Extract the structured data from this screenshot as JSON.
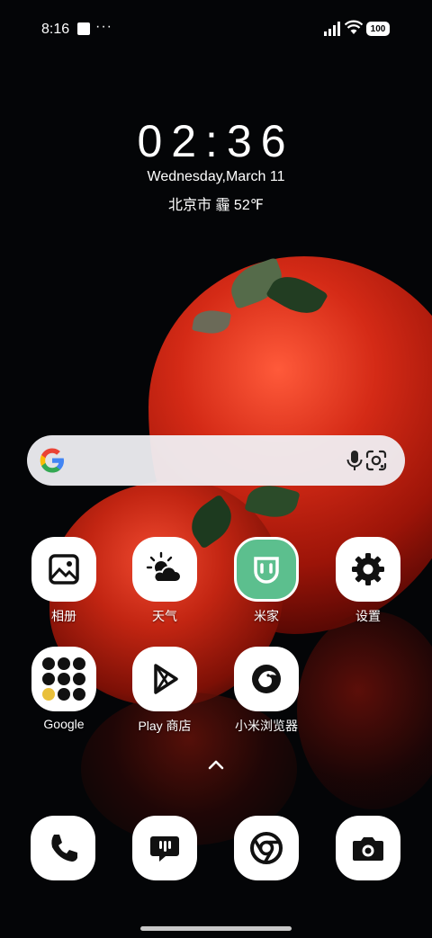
{
  "status_bar": {
    "time": "8:16",
    "dots": "···",
    "battery": "100"
  },
  "clock_widget": {
    "time": "02:36",
    "date": "Wednesday,March 11",
    "weather": "北京市 霾 52℉"
  },
  "search_bar": {
    "logo_icon": "google-g-icon",
    "mic_icon": "mic-icon",
    "lens_icon": "google-lens-icon"
  },
  "apps": [
    {
      "label": "相册",
      "icon": "photos-icon"
    },
    {
      "label": "天气",
      "icon": "weather-icon"
    },
    {
      "label": "米家",
      "icon": "mijia-icon"
    },
    {
      "label": "设置",
      "icon": "settings-gear-icon"
    },
    {
      "label": "Google",
      "icon": "google-folder-icon"
    },
    {
      "label": "Play 商店",
      "icon": "play-store-icon"
    },
    {
      "label": "小米浏览器",
      "icon": "mi-browser-icon"
    }
  ],
  "dock": [
    {
      "icon": "phone-icon"
    },
    {
      "icon": "messages-icon"
    },
    {
      "icon": "chrome-icon"
    },
    {
      "icon": "camera-icon"
    }
  ],
  "colors": {
    "mijia_green": "#5cbf8e",
    "icon_background": "#ffffff",
    "search_bar_bg": "#f0f0f4"
  }
}
